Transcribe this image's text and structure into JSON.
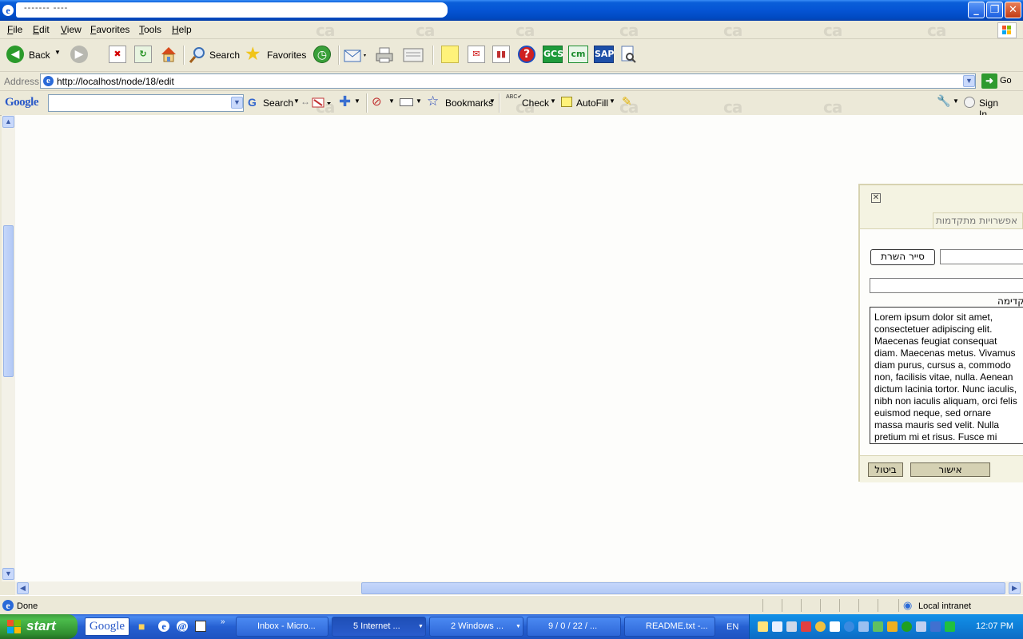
{
  "window": {
    "title": "-------                   ----",
    "controls": {
      "minimize": "_",
      "restore": "❐",
      "close": "✕"
    }
  },
  "menu": [
    "File",
    "Edit",
    "View",
    "Favorites",
    "Tools",
    "Help"
  ],
  "toolbar": {
    "back_label": "Back",
    "search_label": "Search",
    "favorites_label": "Favorites",
    "gcs_label": "GCS",
    "cm_label": "cm",
    "sap_label": "SAP"
  },
  "address": {
    "label": "Address",
    "url": "http://localhost/node/18/edit",
    "go_label": "Go"
  },
  "google_toolbar": {
    "logo": "Google",
    "search_label": "Search",
    "bookmarks_label": "Bookmarks",
    "check_label": "Check",
    "autofill_label": "AutoFill",
    "signin_label": "Sign In"
  },
  "dialog": {
    "tab_label": "אפשרויות מתקדמות",
    "browse_button": "סייר השרת",
    "preview_label": "תצוגה מקדימה",
    "preview_text": "Lorem ipsum dolor sit amet, consectetuer adipiscing elit. Maecenas feugiat consequat diam. Maecenas metus. Vivamus diam purus, cursus a, commodo non, facilisis vitae, nulla. Aenean dictum lacinia tortor. Nunc iaculis, nibh non iaculis aliquam, orci felis euismod neque, sed ornare massa mauris sed velit. Nulla pretium mi et risus. Fusce mi pede, tempor id, cursus ac",
    "ok_button": "אישור",
    "cancel_button": "ביטול"
  },
  "status": {
    "text": "Done",
    "zone": "Local intranet"
  },
  "taskbar": {
    "start_label": "start",
    "google_label": "Google",
    "tasks": [
      "Inbox - Micro...",
      "5 Internet ...",
      "2 Windows ...",
      "9 / 0 / 22 / ...",
      "README.txt -..."
    ],
    "language": "EN",
    "clock": "12:07 PM"
  },
  "colors": {
    "xp_blue": "#0554d4",
    "taskbar_blue": "#2660d2",
    "start_green": "#3c9a3c",
    "dialog_border": "#d7d3b1",
    "dialog_header": "#f4f3e2"
  }
}
